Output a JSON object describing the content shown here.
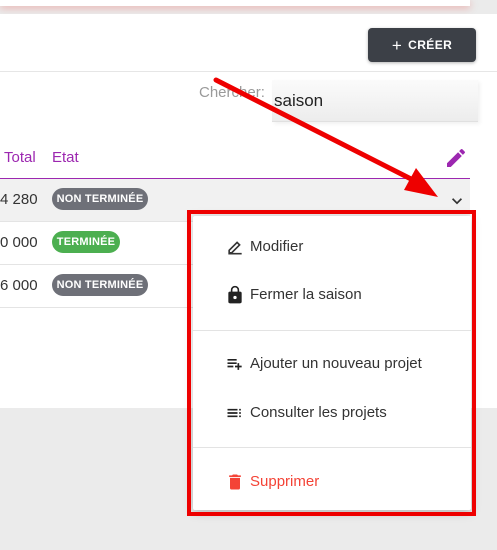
{
  "header": {
    "create_label": "CRÉER",
    "create_icon": "plus-icon"
  },
  "search": {
    "label": "Chercher:",
    "value": "saison"
  },
  "table": {
    "columns": [
      "Total",
      "Etat"
    ],
    "rows": [
      {
        "total": "4 280",
        "status": "NON TERMINÉE",
        "status_kind": "pending"
      },
      {
        "total": "0 000",
        "status": "TERMINÉE",
        "status_kind": "done"
      },
      {
        "total": "6 000",
        "status": "NON TERMINÉE",
        "status_kind": "pending"
      }
    ]
  },
  "menu": {
    "items": [
      {
        "label": "Modifier",
        "icon": "edit-icon"
      },
      {
        "label": "Fermer la saison",
        "icon": "lock-icon"
      },
      {
        "label": "Ajouter un nouveau projet",
        "icon": "playlist-add-icon"
      },
      {
        "label": "Consulter les projets",
        "icon": "list-icon"
      },
      {
        "label": "Supprimer",
        "icon": "trash-icon"
      }
    ]
  },
  "colors": {
    "accent": "#9c27b0",
    "danger": "#f44336",
    "success": "#4caf50",
    "badge_grey": "#6e7078",
    "button_dark": "#3c4047",
    "annotation_red": "#ee0000"
  }
}
